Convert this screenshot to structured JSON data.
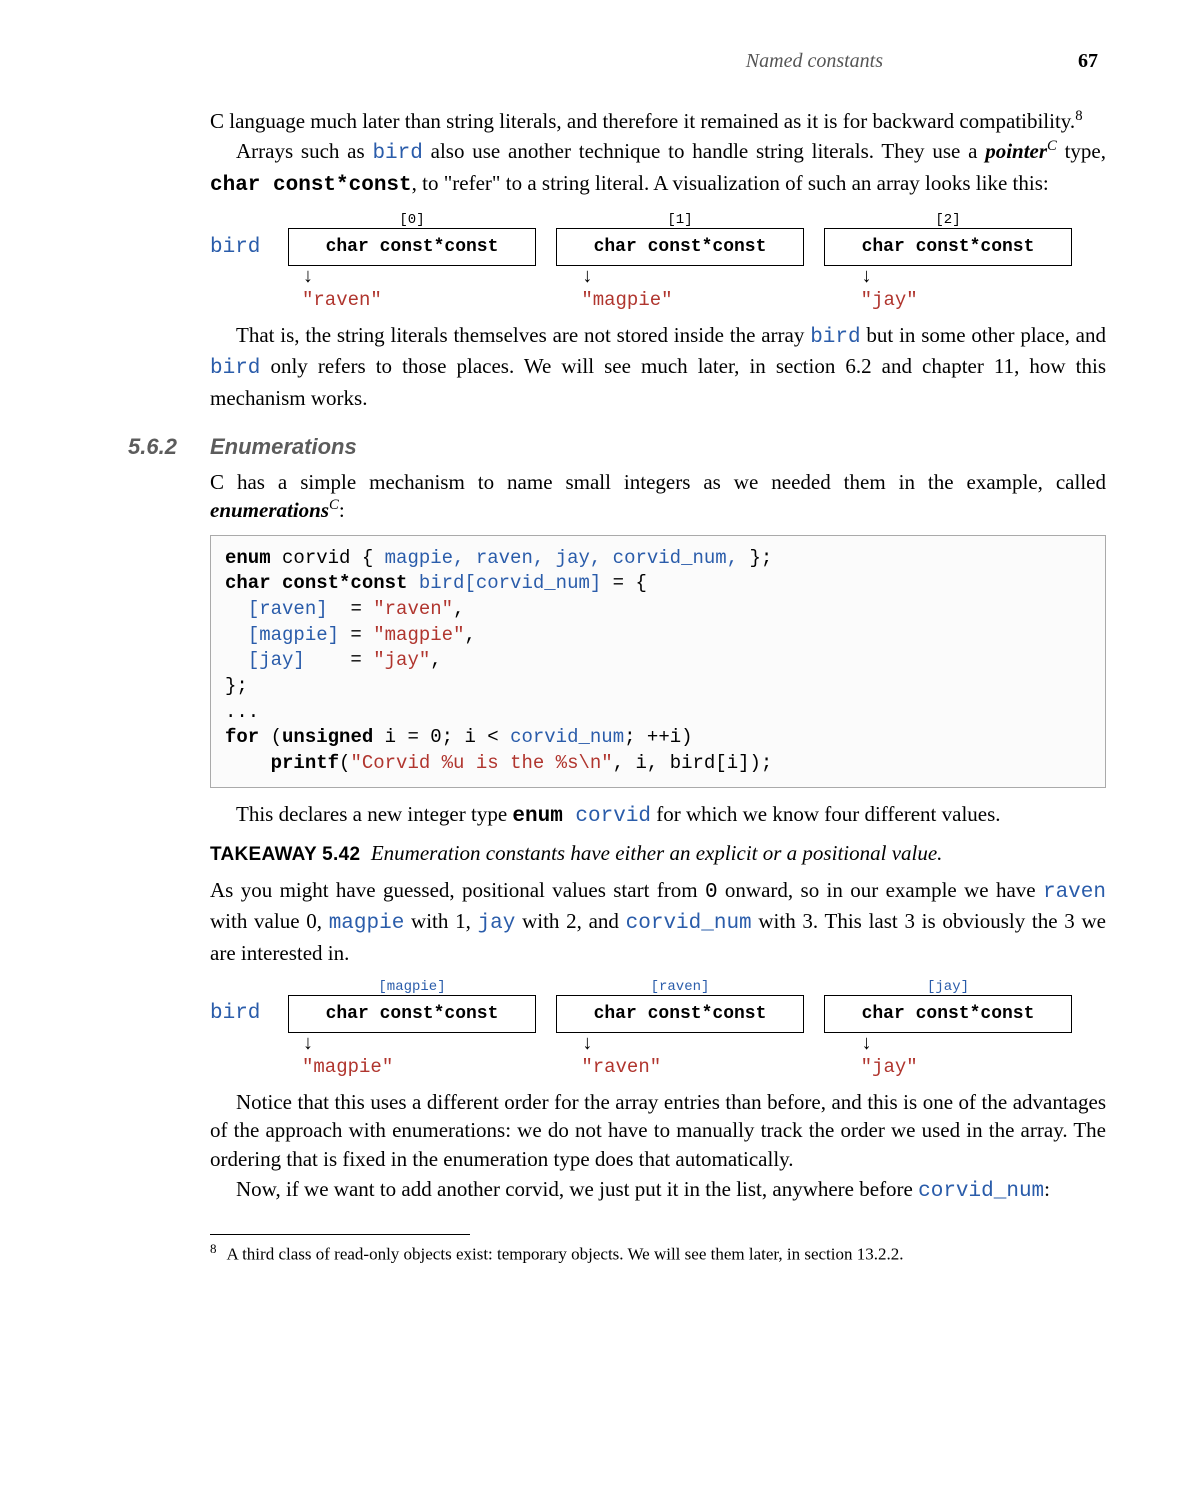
{
  "header": {
    "section_title": "Named constants",
    "page_number": "67"
  },
  "para1": "C language much later than string literals, and therefore it remained as it is for backward compatibility.",
  "fn1_ref": "8",
  "para2_a": "Arrays such as ",
  "para2_bird": "bird",
  "para2_b": " also use another technique to handle string literals.  They use a ",
  "pointer_word": "pointer",
  "para2_c": " type, ",
  "type_str": "char  const*const",
  "para2_d": ", to \"refer\" to a string literal.  A visualization of such an array looks like this:",
  "diagram1": {
    "label": "bird",
    "indices": [
      "[0]",
      "[1]",
      "[2]"
    ],
    "cell_type": "char const*const",
    "values": [
      "\"raven\"",
      "\"magpie\"",
      "\"jay\""
    ]
  },
  "para3_a": "That is, the string literals themselves are not stored inside the array ",
  "para3_bird1": "bird",
  "para3_b": " but in some other place, and ",
  "para3_bird2": "bird",
  "para3_c": " only refers to those places. We will see much later, in section 6.2 and chapter 11, how this mechanism works.",
  "section": {
    "number": "5.6.2",
    "title": "Enumerations"
  },
  "para4_a": "C has a simple mechanism to name small integers as we needed them in the example, called ",
  "enum_word": "enumerations",
  "para4_b": ":",
  "code": {
    "l1_kw": "enum",
    "l1_rest_a": " corvid { ",
    "l1_ids": "magpie, raven, jay, corvid_num,",
    "l1_rest_b": " };",
    "l2_kw": "char const*const",
    "l2_id": " bird[corvid_num]",
    "l2_rest": " = {",
    "l3_id": "[raven]",
    "l3_eq": "  = ",
    "l3_str": "\"raven\"",
    "l3_end": ",",
    "l4_id": "[magpie]",
    "l4_eq": " = ",
    "l4_str": "\"magpie\"",
    "l4_end": ",",
    "l5_id": "[jay]",
    "l5_eq": "    = ",
    "l5_str": "\"jay\"",
    "l5_end": ",",
    "l6": "};",
    "l7": "...",
    "l8_kw1": "for",
    "l8_a": " (",
    "l8_kw2": "unsigned",
    "l8_b": " i = 0; i < ",
    "l8_id": "corvid_num",
    "l8_c": "; ++i)",
    "l9_pad": "    ",
    "l9_kw": "printf",
    "l9_a": "(",
    "l9_str": "\"Corvid %u is the %s\\n\"",
    "l9_b": ", i, bird[i]);"
  },
  "para5_a": "This declares a new integer type ",
  "para5_kw": "enum",
  "para5_id": " corvid",
  "para5_b": " for which we know four different values.",
  "takeaway": {
    "label": "TAKEAWAY 5.42",
    "text": "Enumeration constants have either an explicit or a positional value."
  },
  "para6_a": "As you might have guessed, positional values start from ",
  "para6_zero": "0",
  "para6_b": " onward, so in our example we have ",
  "para6_raven": "raven",
  "para6_c": " with value 0, ",
  "para6_magpie": "magpie",
  "para6_d": " with 1, ",
  "para6_jay": "jay",
  "para6_e": " with 2, and ",
  "para6_cn": "corvid_num",
  "para6_f": " with 3. This last 3 is obviously the 3 we are interested in.",
  "diagram2": {
    "label": "bird",
    "indices": [
      "[magpie]",
      "[raven]",
      "[jay]"
    ],
    "cell_type": "char const*const",
    "values": [
      "\"magpie\"",
      "\"raven\"",
      "\"jay\""
    ]
  },
  "para7": "Notice that this uses a different order for the array entries than before, and this is one of the advantages of the approach with enumerations: we do not have to manually track the order we used in the array. The ordering that is fixed in the enumeration type does that automatically.",
  "para8_a": "Now, if we want to add another corvid, we just put it in the list, anywhere before ",
  "para8_cn": "corvid_num",
  "para8_b": ":",
  "footnote": {
    "num": "8",
    "text": "A third class of read-only objects exist: temporary objects. We will see them later, in section 13.2.2."
  }
}
